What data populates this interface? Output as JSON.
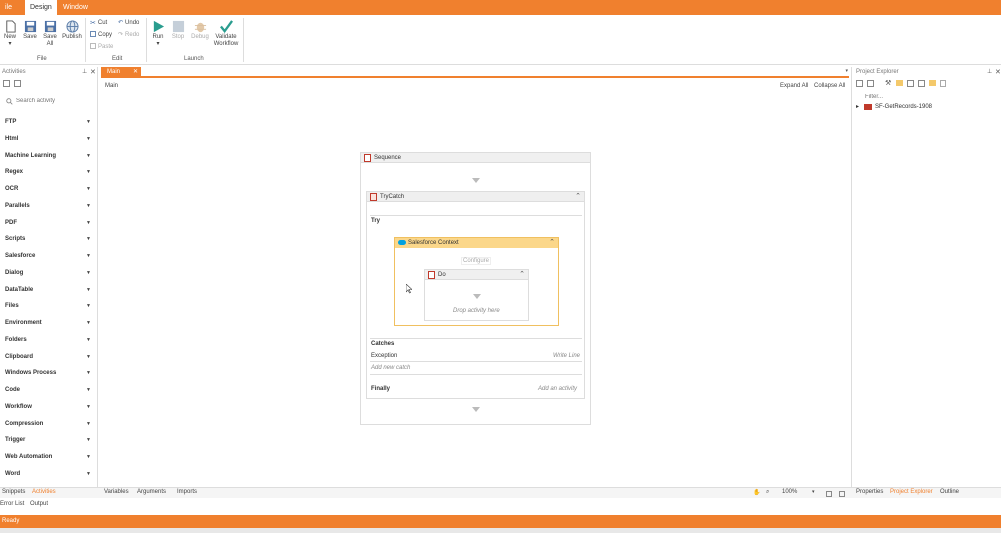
{
  "menu": {
    "file": "ile",
    "design": "Design",
    "window": "Window"
  },
  "ribbon": {
    "new": "New",
    "save": "Save",
    "save_all_1": "Save",
    "save_all_2": "All",
    "publish": "Publish",
    "cut": "Cut",
    "copy": "Copy",
    "paste": "Paste",
    "undo": "Undo",
    "redo": "Redo",
    "run": "Run",
    "stop": "Stop",
    "debug": "Debug",
    "validate_1": "Validate",
    "validate_2": "Workflow",
    "group_file": "File",
    "group_edit": "Edit",
    "group_launch": "Launch"
  },
  "activities": {
    "title": "Activities",
    "search_placeholder": "Search activity",
    "categories": [
      "FTP",
      "Html",
      "Machine Learning",
      "Regex",
      "OCR",
      "Parallels",
      "PDF",
      "Scripts",
      "Salesforce",
      "Dialog",
      "DataTable",
      "Files",
      "Environment",
      "Folders",
      "Clipboard",
      "Windows Process",
      "Code",
      "Workflow",
      "Compression",
      "Trigger",
      "Web Automation",
      "Word"
    ]
  },
  "doc": {
    "tab_label": "Main",
    "breadcrumb": "Main",
    "expand_all": "Expand All",
    "collapse_all": "Collapse All"
  },
  "workflow": {
    "sequence": "Sequence",
    "trycatch": "TryCatch",
    "try": "Try",
    "salesforce": "Salesforce Context",
    "configure": "Configure",
    "do": "Do",
    "drop_hint": "Drop activity here",
    "catches": "Catches",
    "exception": "Exception",
    "write_line": "Write Line",
    "add_new_catch": "Add new catch",
    "finally": "Finally",
    "add_activity": "Add an activity"
  },
  "project": {
    "title": "Project Explorer",
    "filter_placeholder": "Filter...",
    "tree_item": "SF-GetRecords-1908"
  },
  "bottom": {
    "snippets": "Snippets",
    "activities": "Activities",
    "variables": "Variables",
    "arguments": "Arguments",
    "imports": "Imports",
    "zoom": "100%",
    "properties": "Properties",
    "project_explorer": "Project Explorer",
    "outline": "Outline",
    "error_list": "Error List",
    "output": "Output",
    "status": "Ready"
  },
  "colors": {
    "accent": "#f0802e",
    "salesforce_header": "#fbd78a",
    "salesforce_border": "#f0c060",
    "run_green": "#2a9d8f"
  }
}
